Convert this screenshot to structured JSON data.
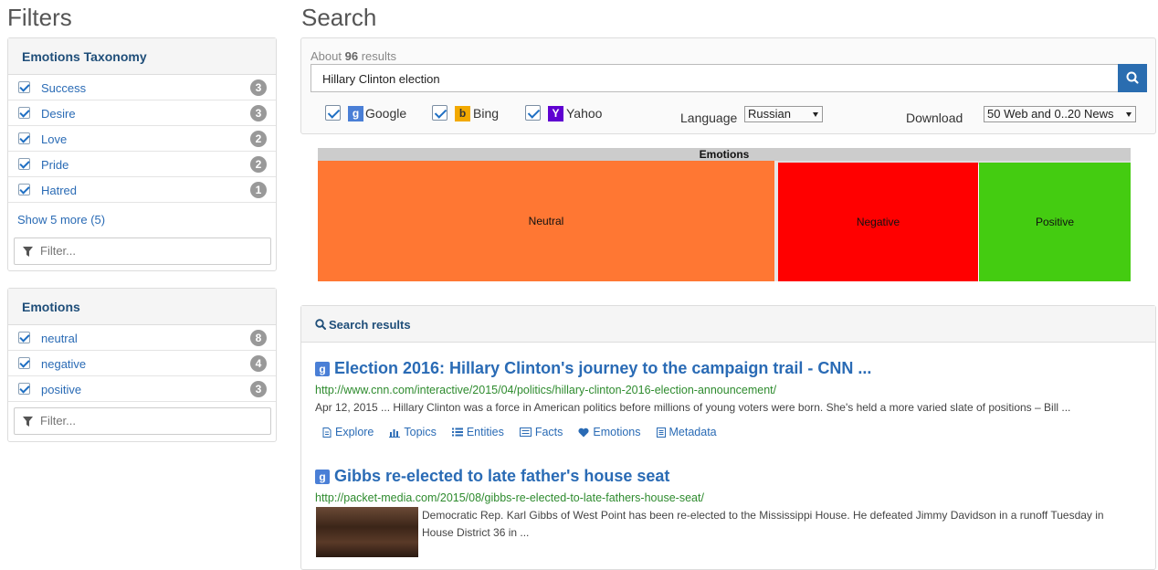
{
  "filters_title": "Filters",
  "search_title": "Search",
  "taxonomy_panel": {
    "title": "Emotions Taxonomy",
    "items": [
      {
        "label": "Success",
        "count": "3"
      },
      {
        "label": "Desire",
        "count": "3"
      },
      {
        "label": "Love",
        "count": "2"
      },
      {
        "label": "Pride",
        "count": "2"
      },
      {
        "label": "Hatred",
        "count": "1"
      }
    ],
    "show_more": "Show 5 more (5)",
    "filter_placeholder": "Filter..."
  },
  "emotions_panel": {
    "title": "Emotions",
    "items": [
      {
        "label": "neutral",
        "count": "8"
      },
      {
        "label": "negative",
        "count": "4"
      },
      {
        "label": "positive",
        "count": "3"
      }
    ],
    "filter_placeholder": "Filter..."
  },
  "search": {
    "about_prefix": "About",
    "result_count": "96",
    "about_suffix": "results",
    "query": "Hillary Clinton election",
    "engines": [
      {
        "name": "Google",
        "checked": true,
        "color": "#4a7fd6"
      },
      {
        "name": "Bing",
        "checked": true,
        "color": "#f2a900"
      },
      {
        "name": "Yahoo",
        "checked": true,
        "color": "#5f01d1"
      }
    ],
    "language_label": "Language",
    "language_value": "Russian",
    "download_label": "Download",
    "download_value": "50 Web and 0..20 News"
  },
  "treemap": {
    "title": "Emotions",
    "cells": [
      {
        "label": "Neutral",
        "color": "#ff7733"
      },
      {
        "label": "Negative",
        "color": "#ff0000"
      },
      {
        "label": "Positive",
        "color": "#44cc11"
      }
    ]
  },
  "results": {
    "header": "Search results",
    "items": [
      {
        "title": "Election 2016: Hillary Clinton's journey to the campaign trail - CNN ...",
        "url": "http://www.cnn.com/interactive/2015/04/politics/hillary-clinton-2016-election-announcement/",
        "snippet": "Apr 12, 2015 ... Hillary Clinton was a force in American politics before millions of young voters were born. She's held a more varied slate of positions – Bill ...",
        "actions": [
          "Explore",
          "Topics",
          "Entities",
          "Facts",
          "Emotions",
          "Metadata"
        ]
      },
      {
        "title": "Gibbs re-elected to late father's house seat",
        "url": "http://packet-media.com/2015/08/gibbs-re-elected-to-late-fathers-house-seat/",
        "snippet": "Democratic Rep. Karl Gibbs of West Point has been re-elected to the Mississippi House. He defeated Jimmy Davidson in a runoff Tuesday in House District 36 in ..."
      }
    ]
  }
}
